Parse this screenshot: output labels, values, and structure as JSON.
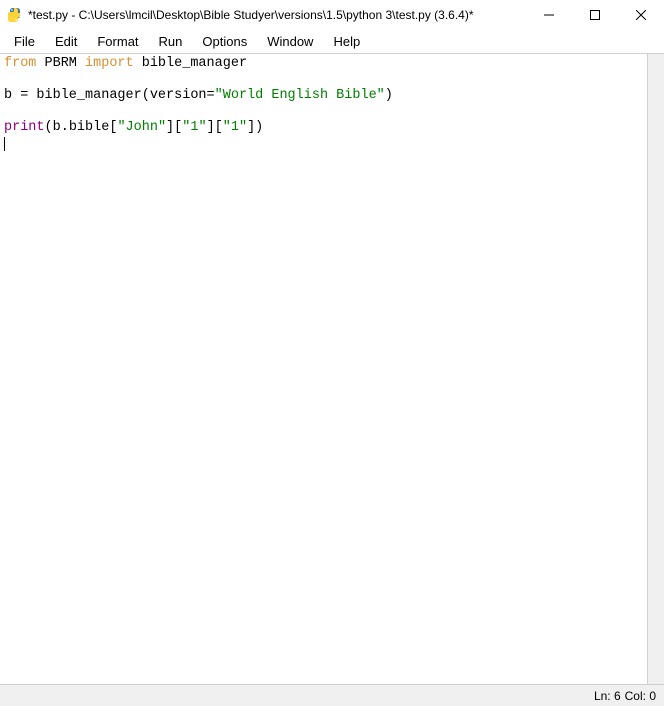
{
  "window": {
    "title": "*test.py - C:\\Users\\lmcil\\Desktop\\Bible Studyer\\versions\\1.5\\python 3\\test.py (3.6.4)*"
  },
  "menu": {
    "file": "File",
    "edit": "Edit",
    "format": "Format",
    "run": "Run",
    "options": "Options",
    "window": "Window",
    "help": "Help"
  },
  "code": {
    "line1": {
      "from": "from",
      "pbrm": " PBRM ",
      "import": "import",
      "bible_manager": " bible_manager"
    },
    "line3": {
      "prefix": "b = bible_manager(version=",
      "string": "\"World English Bible\"",
      "suffix": ")"
    },
    "line5": {
      "print": "print",
      "open": "(b.bible[",
      "john": "\"John\"",
      "mid1": "][",
      "one1": "\"1\"",
      "mid2": "][",
      "one2": "\"1\"",
      "close": "])"
    }
  },
  "status": {
    "ln": "Ln: 6",
    "col": "Col: 0"
  }
}
